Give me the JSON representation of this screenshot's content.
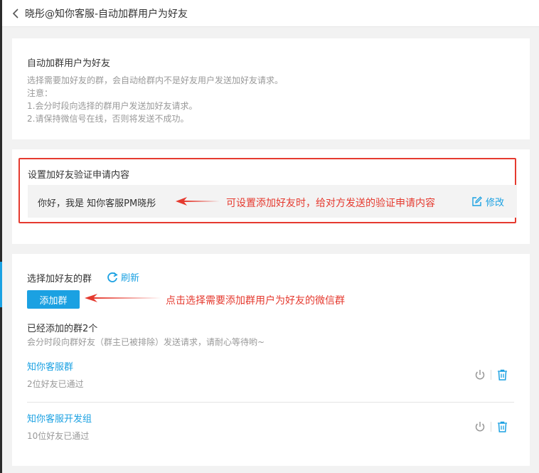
{
  "header": {
    "title": "晓彤@知你客服-自动加群用户为好友"
  },
  "intro": {
    "heading": "自动加群用户为好友",
    "desc1": "选择需要加好友的群，会自动给群内不是好友用户发送加好友请求。",
    "note_label": "注意：",
    "note1": "1.会分时段向选择的群用户发送加好友请求。",
    "note2": "2.请保持微信号在线，否则将发送不成功。"
  },
  "verify": {
    "heading": "设置加好友验证申请内容",
    "message": "你好，我是 知你客服PM晓彤",
    "annotation": "可设置添加好友时，给对方发送的验证申请内容",
    "edit_label": "修改"
  },
  "groups": {
    "heading": "选择加好友的群",
    "refresh_label": "刷新",
    "add_button": "添加群",
    "annotation": "点击选择需要添加群用户为好友的微信群",
    "added_title": "已经添加的群2个",
    "added_note": "会分时段向群好友（群主已被排除）发送请求，请耐心等待哟~",
    "list": [
      {
        "name": "知你客服群",
        "status": "2位好友已通过"
      },
      {
        "name": "知你客服开发组",
        "status": "10位好友已通过"
      }
    ]
  },
  "icons": {
    "back": "chevron-left-icon",
    "edit": "edit-icon",
    "refresh": "refresh-icon",
    "power": "power-icon",
    "delete": "trash-icon"
  },
  "colors": {
    "accent": "#1ba1e2",
    "annotation": "#e53a2f",
    "background": "#f2f2f2"
  }
}
